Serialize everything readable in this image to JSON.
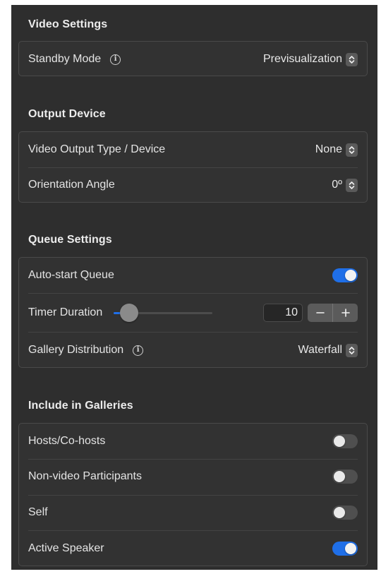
{
  "video_settings": {
    "title": "Video Settings",
    "standby_mode": {
      "label": "Standby Mode",
      "value": "Previsualization"
    }
  },
  "output_device": {
    "title": "Output Device",
    "output_type": {
      "label": "Video Output Type / Device",
      "value": "None"
    },
    "orientation": {
      "label": "Orientation Angle",
      "value": "0º"
    }
  },
  "queue_settings": {
    "title": "Queue Settings",
    "auto_start": {
      "label": "Auto-start Queue",
      "on": true
    },
    "timer_duration": {
      "label": "Timer Duration",
      "value": "10",
      "slider_fraction": 0.16
    },
    "gallery_distribution": {
      "label": "Gallery Distribution",
      "value": "Waterfall"
    }
  },
  "include_in_galleries": {
    "title": "Include in Galleries",
    "items": [
      {
        "label": "Hosts/Co-hosts",
        "on": false
      },
      {
        "label": "Non-video Participants",
        "on": false
      },
      {
        "label": "Self",
        "on": false
      },
      {
        "label": "Active Speaker",
        "on": true
      }
    ]
  },
  "icons": {
    "info": "info-icon",
    "select": "up-down-chevron-icon",
    "minus": "minus-icon",
    "plus": "plus-icon"
  },
  "colors": {
    "accent": "#1f6fe8",
    "panel_bg": "#2e2e2e",
    "group_bg": "#323232",
    "toggle_off": "#4f4f4f"
  }
}
